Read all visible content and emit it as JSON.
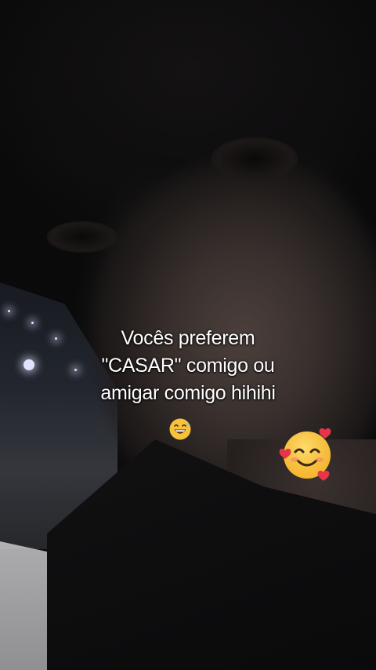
{
  "caption": {
    "line1": "Vocês preferem",
    "line2": "\"CASAR\" comigo ou",
    "line3": "amigar comigo hihihi"
  },
  "emojis": {
    "caption_emoji": "grinning-face-with-sweat",
    "sticker_emoji": "smiling-face-with-hearts"
  },
  "colors": {
    "caption_text": "#ffffff",
    "emoji_yellow": "#f7c23a",
    "heart_red": "#e8344a"
  }
}
